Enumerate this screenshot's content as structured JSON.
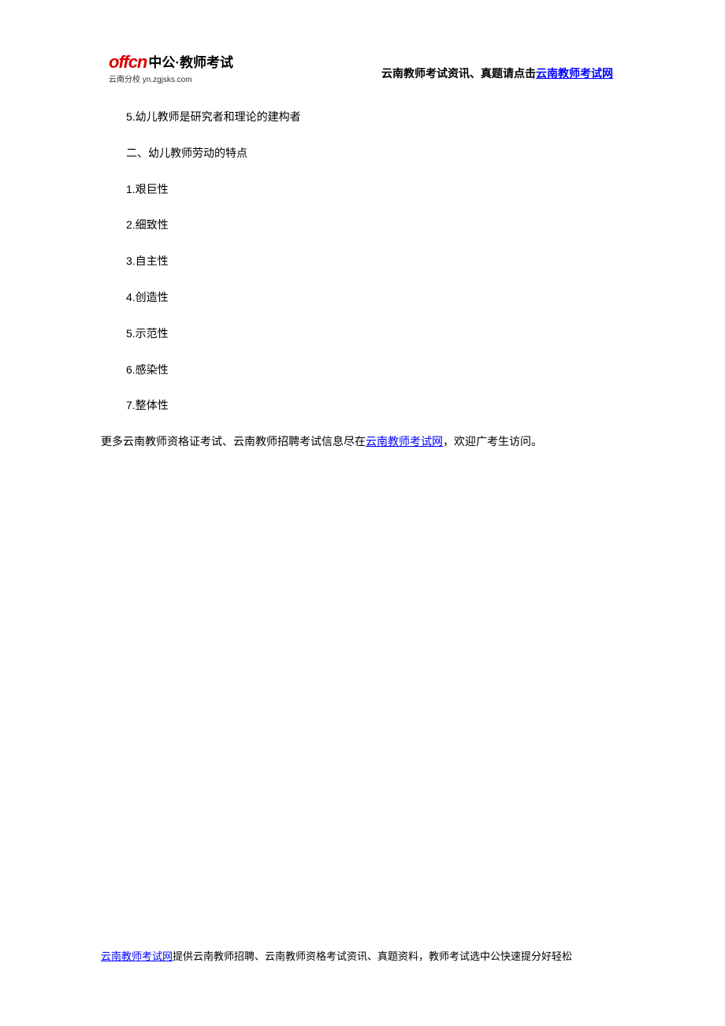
{
  "logo": {
    "brand_en": "offcn",
    "brand_cn": "中公·教师考试",
    "sub": "云南分校 yn.zgjsks.com"
  },
  "header": {
    "prefix": "云南教师考试资讯、真题请点击",
    "link_text": "云南教师考试网"
  },
  "body": {
    "line1": "5.幼儿教师是研究者和理论的建构者",
    "line2": "二、幼儿教师劳动的特点",
    "items": [
      "1.艰巨性",
      "2.细致性",
      "3.自主性",
      "4.创造性",
      "5.示范性",
      "6.感染性",
      "7.整体性"
    ],
    "closing_before": "更多云南教师资格证考试、云南教师招聘考试信息尽在",
    "closing_link": "云南教师考试网",
    "closing_after": "，欢迎广考生访问。"
  },
  "footer": {
    "link_text": "云南教师考试网",
    "suffix": "提供云南教师招聘、云南教师资格考试资讯、真题资料，教师考试选中公快速提分好轻松"
  }
}
